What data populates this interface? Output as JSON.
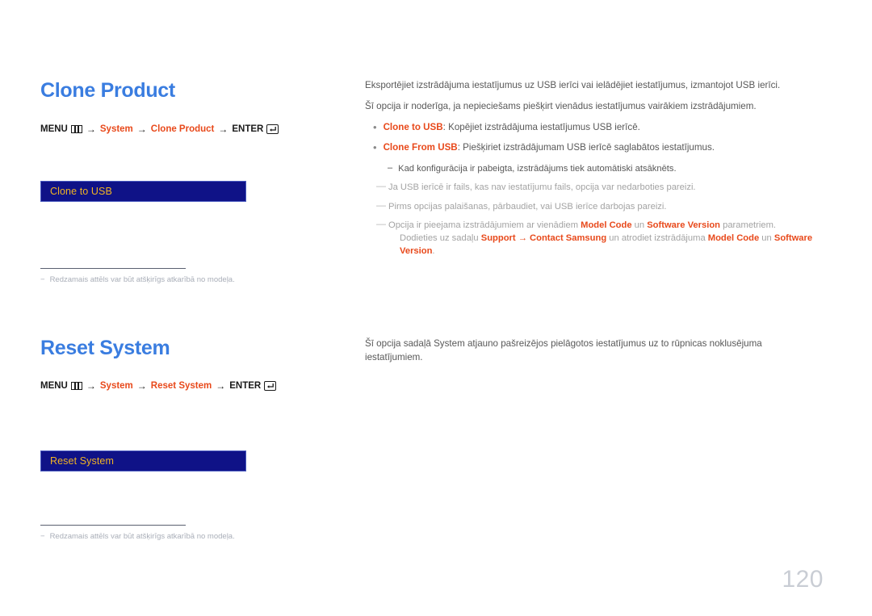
{
  "page": {
    "number": "120",
    "accent_blue": "#3a7de0",
    "accent_orange": "#e8491b",
    "ui_box_bg": "#0f1287",
    "ui_box_text": "#f0b323"
  },
  "sections": [
    {
      "id": "clone-product",
      "title": "Clone Product",
      "menu_path": {
        "menu_label": "MENU",
        "menu_icon": "menu-bars-icon",
        "arrow": "→",
        "steps": [
          "System",
          "Clone Product"
        ],
        "enter_label": "ENTER",
        "enter_icon": "enter-key-icon"
      },
      "ui_box_label": "Clone to USB",
      "footnote": {
        "dash": "−",
        "text": "Redzamais attēls var būt atšķirīgs atkarībā no modeļa."
      },
      "body": {
        "intro": [
          "Eksportējiet izstrādājuma iestatījumus uz USB ierīci vai ielādējiet iestatījumus, izmantojot USB ierīci.",
          "Šī opcija ir noderīga, ja nepieciešams piešķirt vienādus iestatījumus vairākiem izstrādājumiem."
        ],
        "bullets": [
          {
            "bullet": "•",
            "term": "Clone to USB",
            "rest": ": Kopējiet izstrādājuma iestatījumus USB ierīcē."
          },
          {
            "bullet": "•",
            "term": "Clone From USB",
            "rest": ": Piešķiriet izstrādājumam USB ierīcē saglabātos iestatījumus."
          }
        ],
        "sub_dark": {
          "dash": "–",
          "text": "Kad konfigurācija ir pabeigta, izstrādājums tiek automātiski atsāknēts."
        },
        "notes": [
          {
            "dash": "—",
            "text": "Ja USB ierīcē ir fails, kas nav iestatījumu fails, opcija var nedarboties pareizi."
          },
          {
            "dash": "—",
            "text": "Pirms opcijas palaišanas, pārbaudiet, vai USB ierīce darbojas pareizi."
          }
        ],
        "note_rich": {
          "dash": "—",
          "line1_a": "Opcija ir pieejama izstrādājumiem ar vienādiem ",
          "line1_term1": "Model Code",
          "line1_b": " un ",
          "line1_term2": "Software Version",
          "line1_c": " parametriem.",
          "line2_a": "Dodieties uz sadaļu ",
          "line2_term1": "Support",
          "line2_arrow": " → ",
          "line2_term2": "Contact Samsung",
          "line2_b": " un atrodiet izstrādājuma ",
          "line2_term3": "Model Code",
          "line2_c": " un ",
          "line2_term4": "Software Version",
          "line2_d": "."
        }
      }
    },
    {
      "id": "reset-system",
      "title": "Reset System",
      "menu_path": {
        "menu_label": "MENU",
        "menu_icon": "menu-bars-icon",
        "arrow": "→",
        "steps": [
          "System",
          "Reset System"
        ],
        "enter_label": "ENTER",
        "enter_icon": "enter-key-icon"
      },
      "ui_box_label": "Reset System",
      "footnote": {
        "dash": "−",
        "text": "Redzamais attēls var būt atšķirīgs atkarībā no modeļa."
      },
      "body": {
        "intro": [
          "Šī opcija sadaļā System atjauno pašreizējos pielāgotos iestatījumus uz to rūpnicas noklusējuma iestatījumiem."
        ]
      }
    }
  ]
}
